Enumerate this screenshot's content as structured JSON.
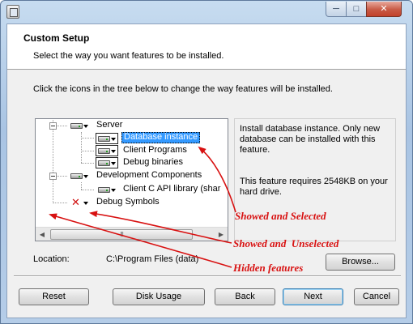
{
  "window": {
    "minimize_glyph": "─",
    "maximize_glyph": "□",
    "close_glyph": "✕"
  },
  "header": {
    "title": "Custom Setup",
    "subtitle": "Select the way you want features to be installed."
  },
  "instructions": "Click the icons in the tree below to change the way features will be installed.",
  "tree": {
    "items": [
      {
        "label": "Server",
        "icon": "drive-icon",
        "state": "showed"
      },
      {
        "label": "Database instance",
        "icon": "drive-icon",
        "state": "selected"
      },
      {
        "label": "Client Programs",
        "icon": "drive-icon",
        "state": "showed"
      },
      {
        "label": "Debug binaries",
        "icon": "drive-icon",
        "state": "showed"
      },
      {
        "label": "Development Components",
        "icon": "drive-icon",
        "state": "showed"
      },
      {
        "label": "Client C API library (shar",
        "icon": "drive-icon",
        "state": "showed"
      },
      {
        "label": "Debug Symbols",
        "icon": "x-icon",
        "state": "unselected"
      }
    ],
    "scroll_thumb_glyph": "III"
  },
  "description": {
    "text": "Install database instance. Only new database can be installed with this feature.",
    "size": "This feature requires 2548KB on your hard drive."
  },
  "location": {
    "label": "Location:",
    "value": "C:\\Program Files (data)"
  },
  "buttons": {
    "browse": "Browse...",
    "reset": "Reset",
    "disk_usage": "Disk Usage",
    "back": "Back",
    "next": "Next",
    "cancel": "Cancel"
  },
  "annotations": [
    {
      "text": "Showed and Selected"
    },
    {
      "text": "Showed and  Unselected"
    },
    {
      "text": "Hidden features"
    }
  ],
  "colors": {
    "annotation": "#d81111",
    "selection": "#3399ff"
  }
}
